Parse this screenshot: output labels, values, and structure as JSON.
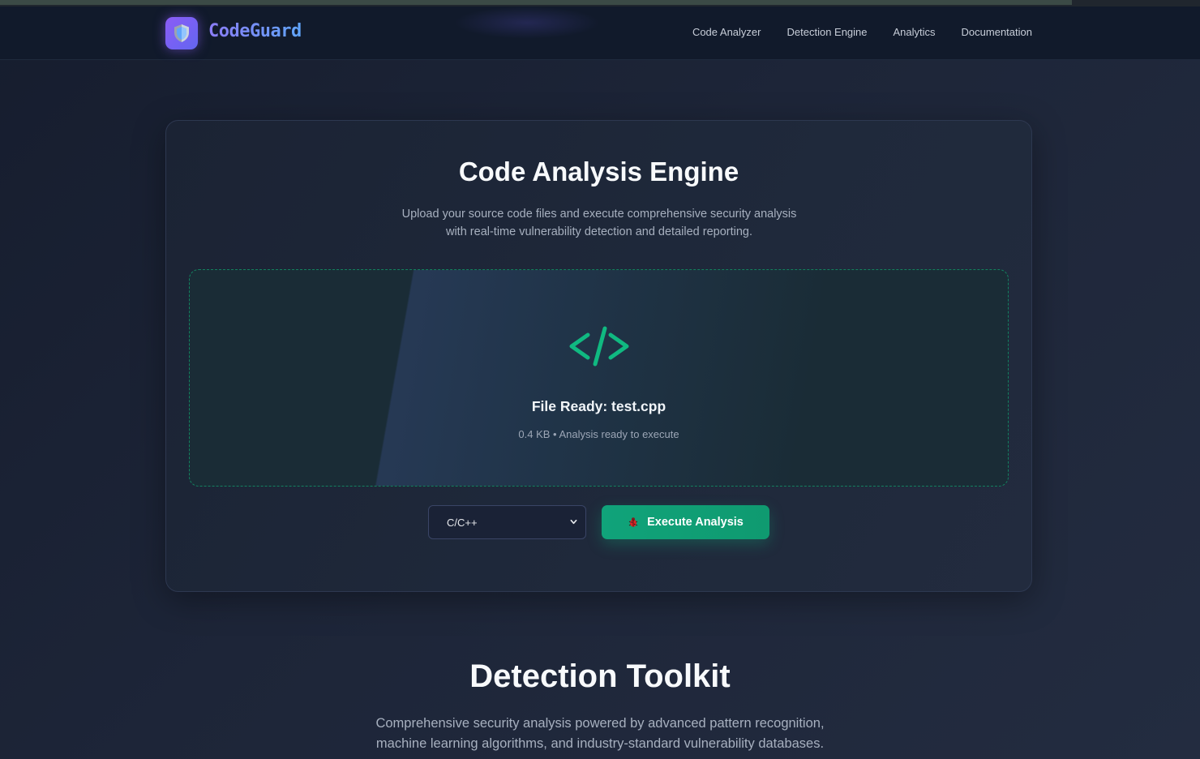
{
  "brand": {
    "name": "CodeGuard",
    "logo_icon": "shield-icon",
    "accent": "#8b5cf6"
  },
  "nav": {
    "items": [
      {
        "label": "Code Analyzer"
      },
      {
        "label": "Detection Engine"
      },
      {
        "label": "Analytics"
      },
      {
        "label": "Documentation"
      }
    ]
  },
  "analysis": {
    "title": "Code Analysis Engine",
    "subtitle": "Upload your source code files and execute comprehensive security analysis with real-time vulnerability detection and detailed reporting.",
    "dropzone": {
      "icon": "code-icon",
      "title": "File Ready: test.cpp",
      "meta": "0.4 KB • Analysis ready to execute",
      "accent": "#10b981"
    },
    "language": {
      "selected": "C/C++"
    },
    "execute": {
      "label": "Execute Analysis",
      "icon": "bug-icon",
      "color": "#10a37a"
    }
  },
  "toolkit": {
    "title": "Detection Toolkit",
    "subtitle": "Comprehensive security analysis powered by advanced pattern recognition, machine learning algorithms, and industry-standard vulnerability databases."
  }
}
